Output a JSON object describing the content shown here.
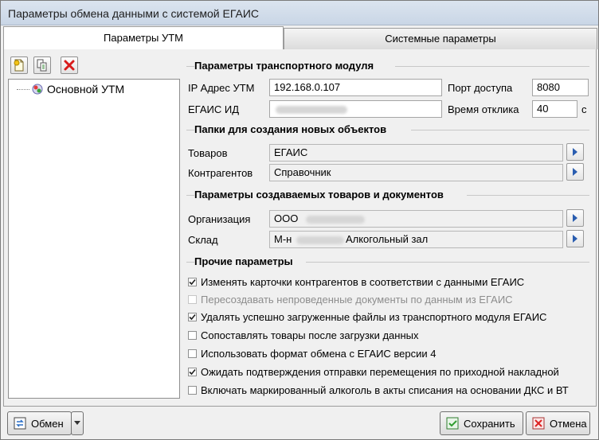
{
  "window": {
    "title": "Параметры обмена данными с системой ЕГАИС"
  },
  "tabs": [
    {
      "label": "Параметры УТМ"
    },
    {
      "label": "Системные параметры"
    }
  ],
  "toolbar": {
    "add_icon": "add-document-icon",
    "copy_icon": "copy-document-icon",
    "delete_icon": "delete-x-icon"
  },
  "tree": {
    "items": [
      {
        "label": "Основной УТМ",
        "icon": "utm-node-icon"
      }
    ]
  },
  "transport": {
    "section_title": "Параметры транспортного модуля",
    "ip_label": "IP Адрес УТМ",
    "ip_value": "192.168.0.107",
    "port_label": "Порт доступа",
    "port_value": "8080",
    "egais_id_label": "ЕГАИС ИД",
    "egais_id_value": "",
    "timeout_label": "Время отклика",
    "timeout_value": "40",
    "timeout_unit": "с"
  },
  "folders": {
    "section_title": "Папки для создания новых объектов",
    "goods_label": "Товаров",
    "goods_value": "ЕГАИС",
    "contractors_label": "Контрагентов",
    "contractors_value": "Справочник"
  },
  "created": {
    "section_title": "Параметры создаваемых товаров и документов",
    "org_label": "Организация",
    "org_value_prefix": "ООО",
    "warehouse_label": "Склад",
    "warehouse_value_prefix": "М-н",
    "warehouse_value_suffix": "Алкогольный зал"
  },
  "other": {
    "section_title": "Прочие параметры",
    "options": [
      {
        "label": "Изменять карточки контрагентов в соответствии с данными ЕГАИС",
        "checked": true,
        "enabled": true
      },
      {
        "label": "Пересоздавать непроведенные документы по данным из ЕГАИС",
        "checked": false,
        "enabled": false
      },
      {
        "label": "Удалять успешно загруженные файлы из транспортного модуля ЕГАИС",
        "checked": true,
        "enabled": true
      },
      {
        "label": "Сопоставлять товары после загрузки данных",
        "checked": false,
        "enabled": true
      },
      {
        "label": "Использовать формат обмена с ЕГАИС версии 4",
        "checked": false,
        "enabled": true
      },
      {
        "label": "Ожидать подтверждения отправки перемещения  по приходной накладной",
        "checked": true,
        "enabled": true
      },
      {
        "label": "Включать маркированный алкоголь в акты списания на основании ДКС и ВТ",
        "checked": false,
        "enabled": true
      }
    ]
  },
  "buttons": {
    "exchange": "Обмен",
    "save": "Сохранить",
    "cancel": "Отмена"
  }
}
